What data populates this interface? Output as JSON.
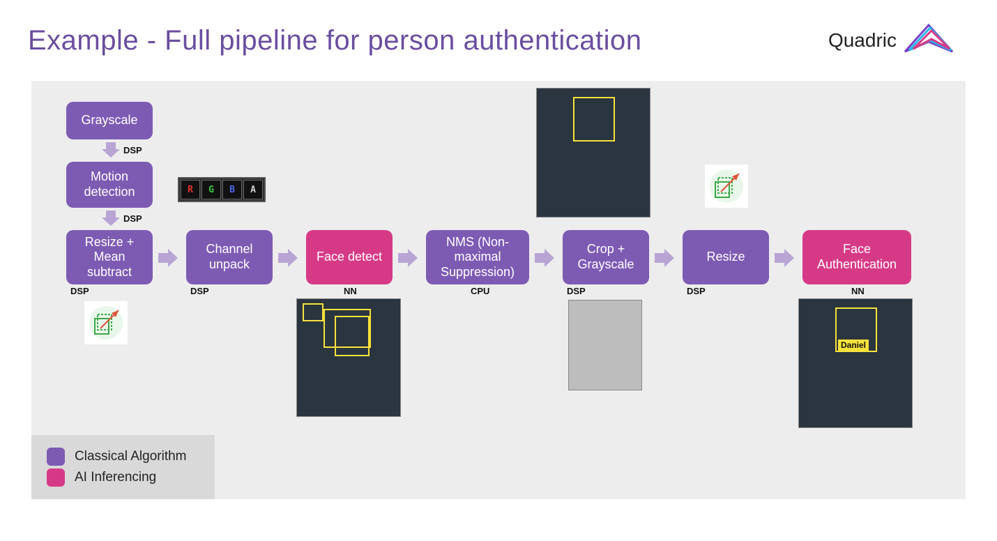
{
  "header": {
    "title": "Example - Full pipeline for person authentication",
    "brand": "Quadric"
  },
  "pipeline": {
    "nodes": [
      {
        "id": "grayscale",
        "label": "Grayscale",
        "type": "classical",
        "proc": "DSP"
      },
      {
        "id": "motion",
        "label": "Motion detection",
        "type": "classical",
        "proc": "DSP"
      },
      {
        "id": "resize-mean",
        "label": "Resize + Mean subtract",
        "type": "classical",
        "proc": "DSP"
      },
      {
        "id": "channel-unpack",
        "label": "Channel unpack",
        "type": "classical",
        "proc": "DSP"
      },
      {
        "id": "face-detect",
        "label": "Face detect",
        "type": "ai",
        "proc": "NN"
      },
      {
        "id": "nms",
        "label": "NMS (Non-maximal Suppression)",
        "type": "classical",
        "proc": "CPU"
      },
      {
        "id": "crop-gray",
        "label": "Crop + Grayscale",
        "type": "classical",
        "proc": "DSP"
      },
      {
        "id": "resize2",
        "label": "Resize",
        "type": "classical",
        "proc": "DSP"
      },
      {
        "id": "face-auth",
        "label": "Face Authentication",
        "type": "ai",
        "proc": "NN"
      }
    ],
    "rgba_channels": [
      "R",
      "G",
      "B",
      "A"
    ],
    "result_name": "Daniel"
  },
  "legend": {
    "classical": "Classical Algorithm",
    "ai": "AI Inferencing"
  },
  "colors": {
    "classical": "#7d5bb3",
    "ai": "#d63a87",
    "title": "#6a4ea0"
  }
}
